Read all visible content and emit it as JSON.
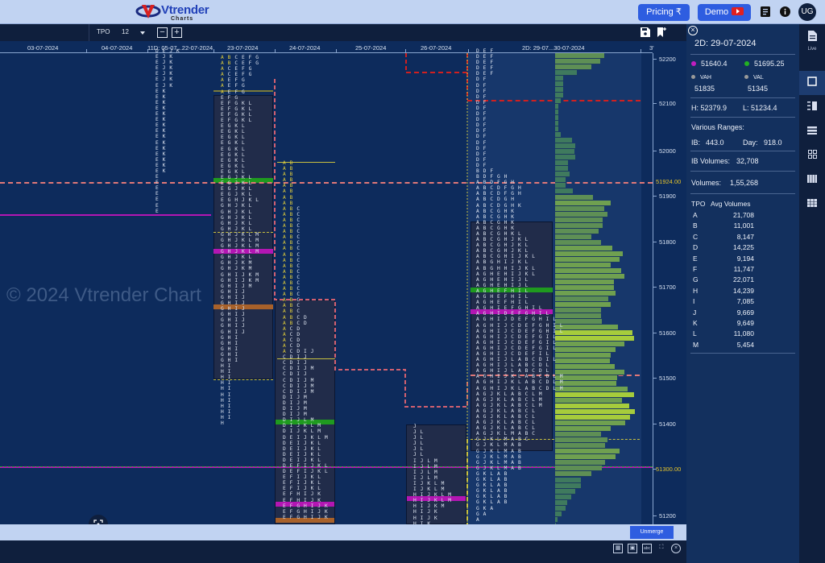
{
  "header": {
    "brand": "Vtrender",
    "brand_sub": "Charts",
    "pricing_label": "Pricing ₹",
    "demo_label": "Demo",
    "avatar_initials": "UG",
    "icons": [
      "notes-icon",
      "info-icon"
    ]
  },
  "toolbar": {
    "mode_label": "TPO",
    "tpo_size": "12",
    "zoom_out": "−",
    "zoom_in": "+",
    "icons": [
      "save-icon",
      "bookmark-icon"
    ]
  },
  "chart": {
    "watermark": "© 2024 Vtrender Chart",
    "dates": [
      "03-07-2024",
      "04-07-2024",
      "11D: 05-07...22-07-2024",
      "23-07-2024",
      "24-07-2024",
      "25-07-2024",
      "26-07-2024",
      "2D: 29-07...30-07-2024",
      "3'"
    ],
    "y_ticks": [
      "52200",
      "52100",
      "52000",
      "51900",
      "51800",
      "51700",
      "51600",
      "51500",
      "51400",
      "51300.00",
      "51200"
    ],
    "price_tags": {
      "upper": "51924.00",
      "lower": "51300.00"
    },
    "tpo_columns": [
      {
        "id": "11d",
        "rows": [
          "D E J K",
          "E J K",
          "E J K",
          "E J K",
          "E J K",
          "E J K",
          "E J K",
          "E K",
          "E K",
          "E K",
          "E K",
          "E K",
          "E K",
          "E K",
          "E K",
          "E K",
          "E K",
          "E K",
          "E K",
          "E K",
          "E K",
          "E K",
          "E",
          "E",
          "E",
          "E",
          "E",
          "E",
          "E"
        ]
      },
      {
        "id": "23-07",
        "rows": [
          "A B C E F G",
          "A B C E F G",
          "A C E F G",
          "A C E F G",
          "A E F G",
          "A E F G",
          "A E F G",
          "E F G",
          "E F G K L",
          "E F G K L",
          "E F G K L",
          "E F G K L",
          "E G K L",
          "E G K L",
          "E G K L",
          "E G K L",
          "E G K L",
          "E G K L",
          "E G K L",
          "E G K L",
          "E G K L",
          "E G J K L",
          "E G J K L",
          "E G J K L",
          "E G J K L",
          "E G H J K L",
          "G H J K L",
          "G H J K L",
          "G H J K L",
          "G H J K L",
          "G H J K L",
          "G H J K L M",
          "G H J K L M",
          "G H J K L M",
          "G H J K L M",
          "G H J K L",
          "G H J K M",
          "G H J K M",
          "G H I J K M",
          "G H I J K M",
          "G H I J M",
          "G H I J",
          "G H I J",
          "G H I J",
          "G H I J",
          "G H I J",
          "G H I J",
          "G H I J",
          "G H I J",
          "G H I",
          "G H I",
          "G H I",
          "G H I",
          "G H I",
          "H I",
          "H I",
          "H I",
          "H I",
          "H I",
          "H I",
          "H I",
          "H I",
          "H I",
          "H I",
          "H"
        ]
      },
      {
        "id": "24-07",
        "rows": [
          "A B",
          "A B",
          "A B",
          "A B",
          "A B",
          "A B",
          "A B",
          "A B",
          "A B C",
          "A B C",
          "A B C",
          "A B C",
          "A B C",
          "A B C",
          "A B C",
          "A B C",
          "A B C",
          "A B C",
          "A B C",
          "A B C",
          "A B C",
          "A B C",
          "A B C",
          "A B C",
          "A B C",
          "A B C",
          "A B C",
          "A B C D",
          "A B C D",
          "A C D",
          "A C D",
          "A C D",
          "A C D",
          "A C D I J",
          "C D I J",
          "C D I J",
          "C D I J M",
          "C D I J",
          "C D I J M",
          "C D I J M",
          "C D I J M",
          "D I J M",
          "D I J M",
          "D I J M",
          "D I J M",
          "D I J L M",
          "D I J K L M",
          "D I J K L M",
          "D E I J K L M",
          "D E I J K L",
          "D E I J K L",
          "D E I J K L",
          "D E I J K L",
          "D E F I J K L",
          "D E F I J K L",
          "E F I J K L",
          "E F I J K L",
          "E F I J K L",
          "E F H I J K",
          "E F H I J K",
          "E F G H I J K",
          "E F G H I J K",
          "E F G H I J K"
        ]
      },
      {
        "id": "26-07",
        "rows": [
          "J",
          "J L",
          "J L",
          "J L",
          "J L",
          "J L",
          "I J L M",
          "I J L M",
          "I J L M",
          "I J L M",
          "I J K L M",
          "I J K L M",
          "H I J K L M",
          "H I J K L M",
          "H I J K M",
          "H I J K",
          "H I J K",
          "H I K"
        ]
      },
      {
        "id": "2d",
        "rows": [
          "D E F",
          "D E F",
          "D E F",
          "D E F",
          "D E F",
          "D F",
          "D F",
          "D F",
          "D F",
          "D F",
          "D F",
          "D F",
          "D F",
          "D F",
          "D F",
          "D F",
          "D F",
          "D F",
          "D F",
          "D F",
          "D F",
          "B D F",
          "B D F G H",
          "A B D F G H",
          "A B C D F G H",
          "A B C D F G H",
          "A B C D G H",
          "A B C D G H K",
          "A B C G H K",
          "A B C G H K",
          "A B C G H K",
          "A B C G H K",
          "A B C G H K L",
          "A B C G H J K L",
          "A B C G H J K L",
          "A B C G H J K L",
          "A B C G H I J K L",
          "A B G H I J K L",
          "A B G H H I J K L",
          "A G H E H I J K L",
          "A G H E H I J L",
          "A G H E H I J L",
          "A G H E F H I L",
          "A G H E F H I L",
          "A G H E F H I L",
          "A G H I E F G H I L",
          "A G H I D E F G H I L",
          "A G H I J D E F G H I L",
          "A G H I J C D E F G H I L",
          "A G H I J C D E F G H I L",
          "A G H I J C D E F G I L",
          "A G H I J C D E F G I L",
          "A G H I J C D E F G I L",
          "A G H I J C D E F I L",
          "A G H I J L A B C D I L",
          "A G H I J L A B C D L",
          "A G H I J L A B C D L",
          "A G H I J K L A B C D L M",
          "A G H I J K L A B C D L M",
          "A G H I J K L A B C D L M",
          "A G J K L A B C L M",
          "A G J K L A B C L M",
          "A G J K L A B C L M",
          "A G J K L A B C L",
          "A G J K L A B C L",
          "A G J K L A B C L",
          "A G J K L A B C L",
          "A G J K L M A B C",
          "G J K L M A B C",
          "G J K L M A B",
          "G J K L M A B",
          "G J K L M A B",
          "G J K L M A B",
          "G J K L M A B",
          "G K L A B",
          "G K L A B",
          "G K L A B",
          "G K L A B",
          "G K L A B",
          "G K L A B",
          "G K A",
          "G A",
          "A"
        ]
      }
    ],
    "volume_profile_relative": [
      0.64,
      0.58,
      0.47,
      0.28,
      0.1,
      0.1,
      0.1,
      0.1,
      0.07,
      0.04,
      0.04,
      0.04,
      0.04,
      0.04,
      0.07,
      0.22,
      0.26,
      0.25,
      0.26,
      0.17,
      0.17,
      0.19,
      0.14,
      0.14,
      0.23,
      0.49,
      0.72,
      0.64,
      0.68,
      0.61,
      0.61,
      0.56,
      0.47,
      0.59,
      0.74,
      0.88,
      0.83,
      0.72,
      0.85,
      0.9,
      0.76,
      0.76,
      0.78,
      0.69,
      0.72,
      0.59,
      0.59,
      0.6,
      0.81,
      1.0,
      1.02,
      0.9,
      0.78,
      0.72,
      0.71,
      0.77,
      0.9,
      0.8,
      0.79,
      0.94,
      1.02,
      0.86,
      0.96,
      1.03,
      0.97,
      0.91,
      0.72,
      0.59,
      0.68,
      0.65,
      0.83,
      0.78,
      0.65,
      0.6,
      0.47,
      0.33,
      0.33,
      0.26,
      0.21,
      0.16,
      0.14,
      0.08,
      0.03,
      0.01
    ]
  },
  "bottom": {
    "unmerge_label": "Unmerge",
    "footer_icons": [
      "grid-icon",
      "image-icon",
      "text-icon",
      "fullscreen-icon",
      "close-icon"
    ]
  },
  "panel": {
    "title": "2D: 29-07-2024",
    "poc": {
      "value": "51640.4",
      "color": "#c01ec0"
    },
    "vwap": {
      "value": "51695.25",
      "color": "#22b022"
    },
    "vah_label": "VAH",
    "vah": "51835",
    "val_label": "VAL",
    "val": "51345",
    "high": "H: 52379.9",
    "low": "L: 51234.4",
    "ranges_label": "Various Ranges:",
    "ib_label": "IB:",
    "ib": "443.0",
    "day_label": "Day:",
    "day": "918.0",
    "ib_volumes_label": "IB Volumes:",
    "ib_volumes": "32,708",
    "volumes_label": "Volumes:",
    "volumes": "1,55,268",
    "tpo_header": "TPO",
    "avg_header": "Avg Volumes",
    "tpo_volumes": [
      {
        "tpo": "A",
        "vol": "21,708"
      },
      {
        "tpo": "B",
        "vol": "11,001"
      },
      {
        "tpo": "C",
        "vol": "8,147"
      },
      {
        "tpo": "D",
        "vol": "14,225"
      },
      {
        "tpo": "E",
        "vol": "9,194"
      },
      {
        "tpo": "F",
        "vol": "11,747"
      },
      {
        "tpo": "G",
        "vol": "22,071"
      },
      {
        "tpo": "H",
        "vol": "14,239"
      },
      {
        "tpo": "I",
        "vol": "7,085"
      },
      {
        "tpo": "J",
        "vol": "9,669"
      },
      {
        "tpo": "K",
        "vol": "9,649"
      },
      {
        "tpo": "L",
        "vol": "11,080"
      },
      {
        "tpo": "M",
        "vol": "5,454"
      }
    ]
  },
  "rail": {
    "live_label": "Live",
    "items": [
      "live-notes-icon",
      "square-view-icon",
      "split-view-icon",
      "rows-view-icon",
      "grid4-view-icon",
      "columns-view-icon",
      "grid9-view-icon"
    ]
  }
}
